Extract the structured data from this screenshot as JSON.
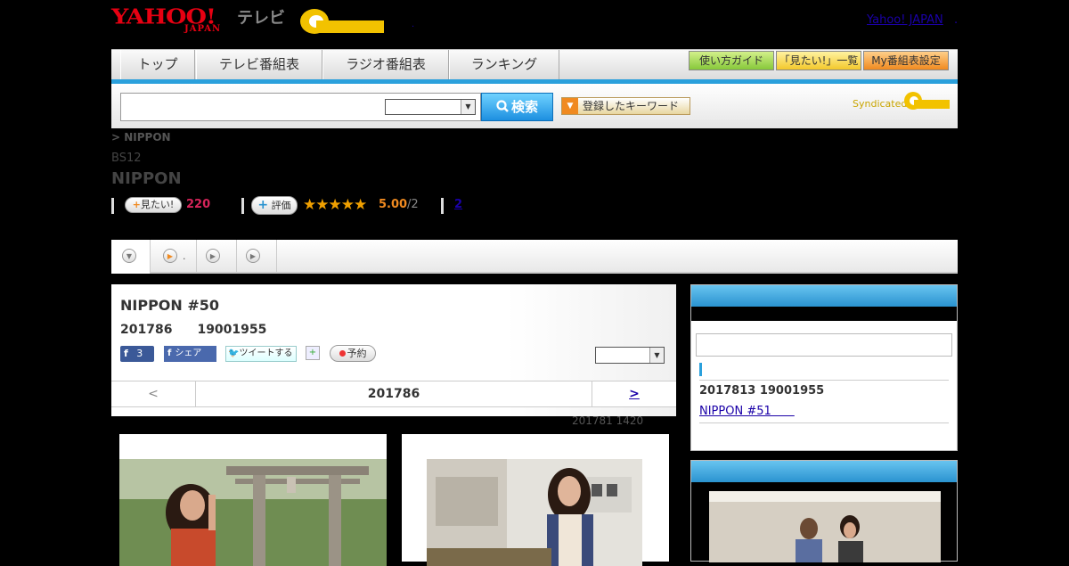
{
  "header": {
    "logo_yahoo": "YAHOO!",
    "logo_japan": "JAPAN",
    "logo_tv": "テレビ",
    "logo_gguide": "G-GUIDE",
    "top_link": "Yahoo! JAPAN",
    "top_link_dot": ".",
    "small_dot": "."
  },
  "nav": {
    "tabs": [
      "トップ",
      "テレビ番組表",
      "ラジオ番組表",
      "ランキング"
    ],
    "buttons": [
      "使い方ガイド",
      "「見たい!」一覧",
      "My番組表設定"
    ],
    "accent_color": "#2aa0dc"
  },
  "search": {
    "query": "",
    "select_value": "",
    "button_label": "検索",
    "keyword_button": "登録したキーワード",
    "syndicated": "Syndicated",
    "syndicated_logo": "G-GUIDE"
  },
  "program": {
    "breadcrumb": "> NIPPON",
    "channel": "BS12",
    "title": "NIPPON",
    "want_label": "見たい!",
    "want_count": "220",
    "rate_label": "評価",
    "stars": "★★★★★",
    "rating_value": 5.0,
    "rating": "5.00",
    "rating_count": "/2",
    "comments": "2"
  },
  "subtabs": [
    {
      "icon": "chevron-down-icon",
      "label": ""
    },
    {
      "icon": "play-icon",
      "label": "."
    },
    {
      "icon": "play-icon",
      "label": ""
    },
    {
      "icon": "play-icon",
      "label": ""
    }
  ],
  "episode": {
    "title": "NIPPON #50",
    "date": "201786　　19001955",
    "fb_like_count": "3",
    "fb_share": "シェア",
    "tweet": "ツイートする",
    "reserve": "予約",
    "select_value": "",
    "pager_prev": "<",
    "pager_current": "201786",
    "pager_next": ">",
    "updated": "201781  1420"
  },
  "sidebar": {
    "next_date": "2017813  19001955",
    "next_link": "NIPPON #51　　"
  },
  "icons": [
    "search-icon",
    "fb-icon",
    "twitter-icon",
    "add-icon",
    "record-icon",
    "play-icon"
  ]
}
